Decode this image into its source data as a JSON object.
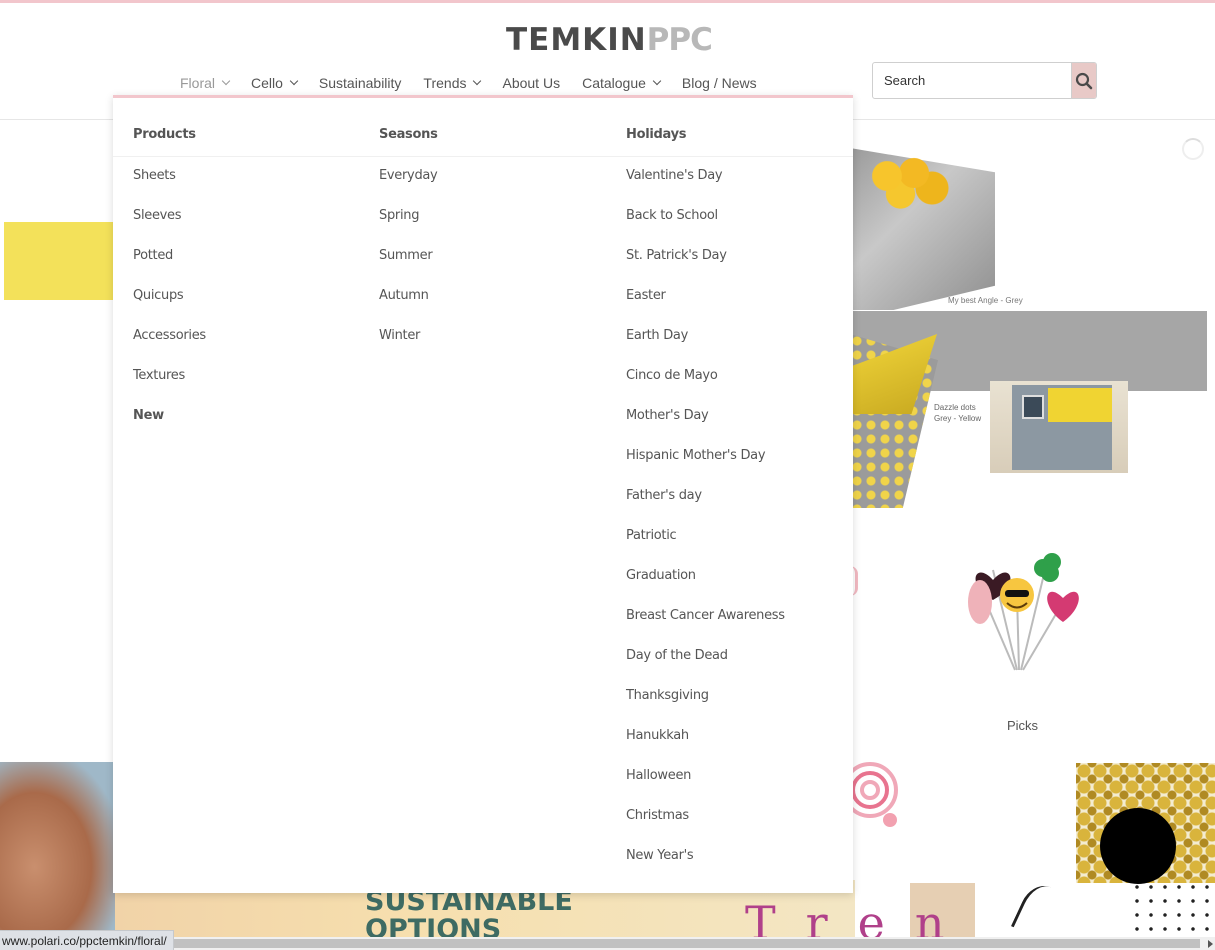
{
  "brand": {
    "name_main": "TEMKIN",
    "name_accent": "PPC"
  },
  "nav": {
    "items": [
      {
        "label": "Floral",
        "dropdown": true
      },
      {
        "label": "Cello",
        "dropdown": true
      },
      {
        "label": "Sustainability",
        "dropdown": false
      },
      {
        "label": "Trends",
        "dropdown": true
      },
      {
        "label": "About Us",
        "dropdown": false
      },
      {
        "label": "Catalogue",
        "dropdown": true
      },
      {
        "label": "Blog / News",
        "dropdown": false
      }
    ]
  },
  "search": {
    "placeholder": "Search",
    "icon": "search-icon"
  },
  "mega_menu": {
    "products": {
      "heading": "Products",
      "items": [
        "Sheets",
        "Sleeves",
        "Potted",
        "Quicups",
        "Accessories",
        "Textures",
        "New"
      ]
    },
    "seasons": {
      "heading": "Seasons",
      "items": [
        "Everyday",
        "Spring",
        "Summer",
        "Autumn",
        "Winter"
      ]
    },
    "holidays": {
      "heading": "Holidays",
      "items": [
        "Valentine's Day",
        "Back to School",
        "St. Patrick's Day",
        "Easter",
        "Earth Day",
        "Cinco de Mayo",
        "Mother's Day",
        "Hispanic Mother's Day",
        "Father's day",
        "Patriotic",
        "Graduation",
        "Breast Cancer Awareness",
        "Day of the Dead",
        "Thanksgiving",
        "Hanukkah",
        "Halloween",
        "Christmas",
        "New Year's"
      ]
    }
  },
  "content": {
    "caption1": "My best Angle - Grey",
    "caption2_line1": "Dazzle dots",
    "caption2_line2": "Grey - Yellow",
    "picks_label": "Picks",
    "sustainable_line1": "SUSTAINABLE",
    "sustainable_line2": "OPTIONS",
    "trend_letters": "Tren"
  },
  "status_url": "www.polari.co/ppctemkin/floral/",
  "colors": {
    "accent_pink": "#f2c6cc",
    "search_button": "#e8c9c7",
    "text": "#555555"
  }
}
